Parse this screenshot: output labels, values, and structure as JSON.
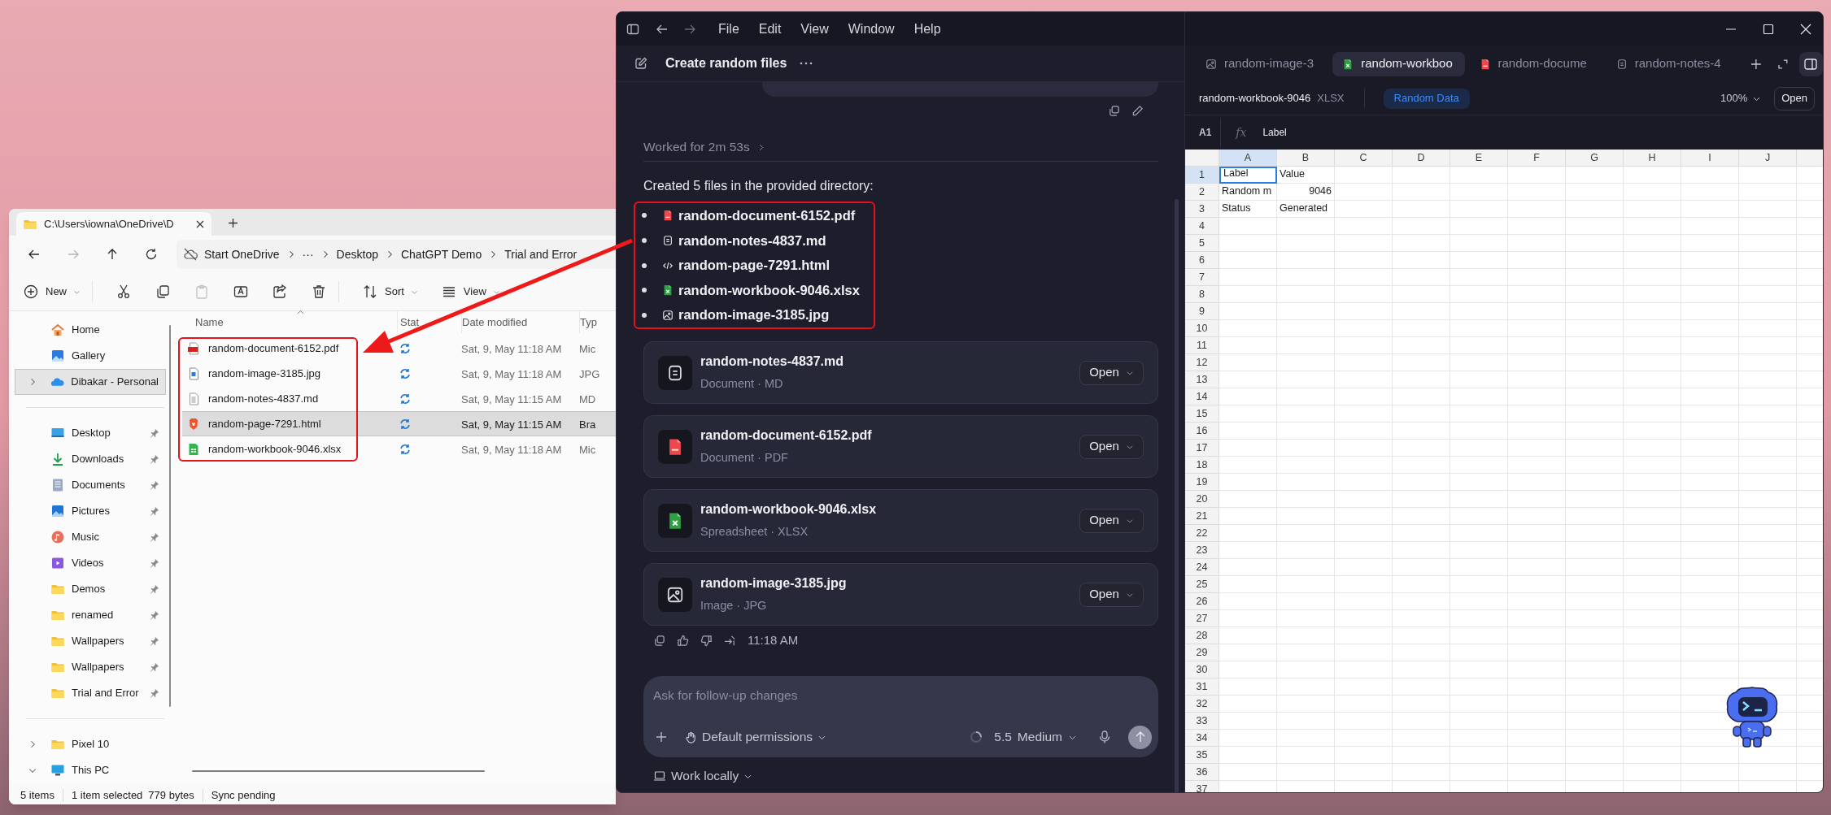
{
  "explorer": {
    "tab_title": "C:\\Users\\iowna\\OneDrive\\D",
    "nav": [
      {
        "kind": "back",
        "disabled": false
      },
      {
        "kind": "forward",
        "disabled": true
      },
      {
        "kind": "up",
        "disabled": false
      },
      {
        "kind": "refresh",
        "disabled": false
      }
    ],
    "breadcrumbs": [
      {
        "kind": "cloud",
        "label": "Start OneDrive"
      },
      {
        "kind": "plain",
        "label": "···"
      },
      {
        "kind": "plain",
        "label": "Desktop"
      },
      {
        "kind": "plain",
        "label": "ChatGPT Demo"
      },
      {
        "kind": "plain",
        "label": "Trial and Error"
      }
    ],
    "toolbar": [
      {
        "kind": "new",
        "label": "New",
        "disabled": false
      },
      {
        "kind": "cut",
        "disabled": false
      },
      {
        "kind": "copy",
        "disabled": false
      },
      {
        "kind": "paste",
        "disabled": true
      },
      {
        "kind": "rename",
        "disabled": false
      },
      {
        "kind": "share",
        "disabled": false
      },
      {
        "kind": "delete",
        "disabled": false
      },
      {
        "kind": "sort",
        "label": "Sort",
        "disabled": false
      },
      {
        "kind": "view",
        "label": "View",
        "disabled": false
      }
    ],
    "sidebar": {
      "sections": [
        {
          "items": [
            {
              "label": "Home",
              "kind": "home",
              "selected": false,
              "pinned": false
            },
            {
              "label": "Gallery",
              "kind": "gallery",
              "selected": false,
              "pinned": false
            },
            {
              "label": "Dibakar - Personal",
              "kind": "cloud",
              "selected": true,
              "pinned": false,
              "expanded": false
            }
          ]
        },
        {
          "items": [
            {
              "label": "Desktop",
              "kind": "desktop",
              "selected": false,
              "pinned": true
            },
            {
              "label": "Downloads",
              "kind": "downloads",
              "selected": false,
              "pinned": true
            },
            {
              "label": "Documents",
              "kind": "documents",
              "selected": false,
              "pinned": true
            },
            {
              "label": "Pictures",
              "kind": "pictures",
              "selected": false,
              "pinned": true
            },
            {
              "label": "Music",
              "kind": "music",
              "selected": false,
              "pinned": true
            },
            {
              "label": "Videos",
              "kind": "videos",
              "selected": false,
              "pinned": true
            },
            {
              "label": "Demos",
              "kind": "folder",
              "selected": false,
              "pinned": true
            },
            {
              "label": "renamed",
              "kind": "folder",
              "selected": false,
              "pinned": true
            },
            {
              "label": "Wallpapers",
              "kind": "folder",
              "selected": false,
              "pinned": true
            },
            {
              "label": "Wallpapers",
              "kind": "folder",
              "selected": false,
              "pinned": true
            },
            {
              "label": "Trial and Error",
              "kind": "folder",
              "selected": false,
              "pinned": true
            }
          ]
        },
        {
          "items": [
            {
              "label": "Pixel 10",
              "kind": "folder",
              "selected": false,
              "pinned": false,
              "expanded": false
            },
            {
              "label": "This PC",
              "kind": "pc",
              "selected": false,
              "pinned": false,
              "expanded": true
            }
          ]
        }
      ]
    },
    "columns": [
      "Name",
      "Stat",
      "Date modified",
      "Typ"
    ],
    "rows": [
      {
        "name": "random-document-6152.pdf",
        "kind": "pdf",
        "date": "Sat, 9, May 11:18 AM",
        "type": "Mic",
        "selected": false
      },
      {
        "name": "random-image-3185.jpg",
        "kind": "image",
        "date": "Sat, 9, May 11:18 AM",
        "type": "JPG",
        "selected": false
      },
      {
        "name": "random-notes-4837.md",
        "kind": "notes",
        "date": "Sat, 9, May 11:15 AM",
        "type": "MD",
        "selected": false
      },
      {
        "name": "random-page-7291.html",
        "kind": "html",
        "date": "Sat, 9, May 11:15 AM",
        "type": "Bra",
        "selected": true
      },
      {
        "name": "random-workbook-9046.xlsx",
        "kind": "xlsx",
        "date": "Sat, 9, May 11:18 AM",
        "type": "Mic",
        "selected": false
      }
    ],
    "status_bar": [
      [
        "5 items"
      ],
      [
        "1 item selected",
        "779 bytes"
      ],
      [
        "Sync pending"
      ]
    ]
  },
  "chat": {
    "menu": [
      "File",
      "Edit",
      "View",
      "Window",
      "Help"
    ],
    "title": "Create random files",
    "worked_for": "Worked for 2m 53s",
    "summary": "Created 5 files in the provided directory:",
    "created_files": [
      {
        "name": "random-document-6152.pdf",
        "kind": "pdf"
      },
      {
        "name": "random-notes-4837.md",
        "kind": "notes"
      },
      {
        "name": "random-page-7291.html",
        "kind": "html"
      },
      {
        "name": "random-workbook-9046.xlsx",
        "kind": "xlsx"
      },
      {
        "name": "random-image-3185.jpg",
        "kind": "image"
      }
    ],
    "attachments": [
      {
        "name": "random-notes-4837.md",
        "kind": "notes",
        "type": "Document · MD",
        "button": "Open"
      },
      {
        "name": "random-document-6152.pdf",
        "kind": "pdf",
        "type": "Document · PDF",
        "button": "Open"
      },
      {
        "name": "random-workbook-9046.xlsx",
        "kind": "xlsx",
        "type": "Spreadsheet · XLSX",
        "button": "Open"
      },
      {
        "name": "random-image-3185.jpg",
        "kind": "image",
        "type": "Image · JPG",
        "button": "Open"
      }
    ],
    "time": "11:18 AM",
    "composer": {
      "placeholder": "Ask for follow-up changes",
      "permissions": "Default permissions",
      "model_version": "5.5",
      "effort": "Medium"
    },
    "work_mode": "Work locally"
  },
  "preview": {
    "tabs": [
      {
        "label": "random-image-3",
        "kind": "image",
        "selected": false
      },
      {
        "label": "random-workboo",
        "kind": "xlsx",
        "selected": true
      },
      {
        "label": "random-docume",
        "kind": "pdf",
        "selected": false
      },
      {
        "label": "random-notes-4",
        "kind": "notes",
        "selected": false
      }
    ],
    "file_name": "random-workbook-9046",
    "file_ext": "XLSX",
    "sheet_tab": "Random Data",
    "zoom": "100%",
    "open_button": "Open",
    "formula_bar": {
      "cell": "A1",
      "function_symbol": "fx",
      "value": "Label"
    },
    "sheet": {
      "columns": [
        {
          "label": "A",
          "selected": true
        },
        {
          "label": "B",
          "selected": false
        },
        {
          "label": "C",
          "selected": false
        },
        {
          "label": "D",
          "selected": false
        },
        {
          "label": "E",
          "selected": false
        },
        {
          "label": "F",
          "selected": false
        },
        {
          "label": "G",
          "selected": false
        },
        {
          "label": "H",
          "selected": false
        },
        {
          "label": "I",
          "selected": false
        },
        {
          "label": "J",
          "selected": false
        }
      ],
      "rows": [
        {
          "label": "1",
          "selected": true,
          "cells": [
            {
              "text": "Label",
              "kind": "text",
              "selected": true
            },
            {
              "text": "Value",
              "kind": "text",
              "selected": false
            }
          ]
        },
        {
          "label": "2",
          "selected": false,
          "cells": [
            {
              "text": "Random m",
              "kind": "text",
              "selected": false
            },
            {
              "text": "9046",
              "kind": "number",
              "selected": false
            }
          ]
        },
        {
          "label": "3",
          "selected": false,
          "cells": [
            {
              "text": "Status",
              "kind": "text",
              "selected": false
            },
            {
              "text": "Generated",
              "kind": "text",
              "selected": false
            }
          ]
        },
        {
          "label": "4",
          "selected": false
        },
        {
          "label": "5",
          "selected": false
        },
        {
          "label": "6",
          "selected": false
        },
        {
          "label": "7",
          "selected": false
        },
        {
          "label": "8",
          "selected": false
        },
        {
          "label": "9",
          "selected": false
        },
        {
          "label": "10",
          "selected": false
        },
        {
          "label": "11",
          "selected": false
        },
        {
          "label": "12",
          "selected": false
        },
        {
          "label": "13",
          "selected": false
        },
        {
          "label": "14",
          "selected": false
        },
        {
          "label": "15",
          "selected": false
        },
        {
          "label": "16",
          "selected": false
        },
        {
          "label": "17",
          "selected": false
        },
        {
          "label": "18",
          "selected": false
        },
        {
          "label": "19",
          "selected": false
        },
        {
          "label": "20",
          "selected": false
        },
        {
          "label": "21",
          "selected": false
        },
        {
          "label": "22",
          "selected": false
        },
        {
          "label": "23",
          "selected": false
        },
        {
          "label": "24",
          "selected": false
        },
        {
          "label": "25",
          "selected": false
        },
        {
          "label": "26",
          "selected": false
        },
        {
          "label": "27",
          "selected": false
        },
        {
          "label": "28",
          "selected": false
        },
        {
          "label": "29",
          "selected": false
        },
        {
          "label": "30",
          "selected": false
        },
        {
          "label": "31",
          "selected": false
        },
        {
          "label": "32",
          "selected": false
        },
        {
          "label": "33",
          "selected": false
        },
        {
          "label": "34",
          "selected": false
        },
        {
          "label": "35",
          "selected": false
        },
        {
          "label": "36",
          "selected": false
        },
        {
          "label": "37",
          "selected": false
        }
      ]
    }
  }
}
